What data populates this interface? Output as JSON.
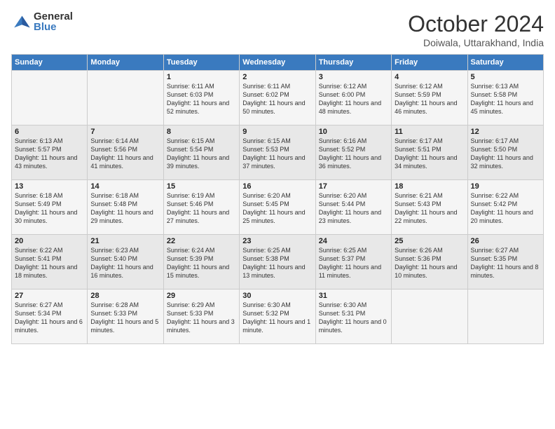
{
  "logo": {
    "general": "General",
    "blue": "Blue"
  },
  "header": {
    "month": "October 2024",
    "location": "Doiwala, Uttarakhand, India"
  },
  "days_of_week": [
    "Sunday",
    "Monday",
    "Tuesday",
    "Wednesday",
    "Thursday",
    "Friday",
    "Saturday"
  ],
  "weeks": [
    [
      {
        "day": "",
        "info": ""
      },
      {
        "day": "",
        "info": ""
      },
      {
        "day": "1",
        "info": "Sunrise: 6:11 AM\nSunset: 6:03 PM\nDaylight: 11 hours and 52 minutes."
      },
      {
        "day": "2",
        "info": "Sunrise: 6:11 AM\nSunset: 6:02 PM\nDaylight: 11 hours and 50 minutes."
      },
      {
        "day": "3",
        "info": "Sunrise: 6:12 AM\nSunset: 6:00 PM\nDaylight: 11 hours and 48 minutes."
      },
      {
        "day": "4",
        "info": "Sunrise: 6:12 AM\nSunset: 5:59 PM\nDaylight: 11 hours and 46 minutes."
      },
      {
        "day": "5",
        "info": "Sunrise: 6:13 AM\nSunset: 5:58 PM\nDaylight: 11 hours and 45 minutes."
      }
    ],
    [
      {
        "day": "6",
        "info": "Sunrise: 6:13 AM\nSunset: 5:57 PM\nDaylight: 11 hours and 43 minutes."
      },
      {
        "day": "7",
        "info": "Sunrise: 6:14 AM\nSunset: 5:56 PM\nDaylight: 11 hours and 41 minutes."
      },
      {
        "day": "8",
        "info": "Sunrise: 6:15 AM\nSunset: 5:54 PM\nDaylight: 11 hours and 39 minutes."
      },
      {
        "day": "9",
        "info": "Sunrise: 6:15 AM\nSunset: 5:53 PM\nDaylight: 11 hours and 37 minutes."
      },
      {
        "day": "10",
        "info": "Sunrise: 6:16 AM\nSunset: 5:52 PM\nDaylight: 11 hours and 36 minutes."
      },
      {
        "day": "11",
        "info": "Sunrise: 6:17 AM\nSunset: 5:51 PM\nDaylight: 11 hours and 34 minutes."
      },
      {
        "day": "12",
        "info": "Sunrise: 6:17 AM\nSunset: 5:50 PM\nDaylight: 11 hours and 32 minutes."
      }
    ],
    [
      {
        "day": "13",
        "info": "Sunrise: 6:18 AM\nSunset: 5:49 PM\nDaylight: 11 hours and 30 minutes."
      },
      {
        "day": "14",
        "info": "Sunrise: 6:18 AM\nSunset: 5:48 PM\nDaylight: 11 hours and 29 minutes."
      },
      {
        "day": "15",
        "info": "Sunrise: 6:19 AM\nSunset: 5:46 PM\nDaylight: 11 hours and 27 minutes."
      },
      {
        "day": "16",
        "info": "Sunrise: 6:20 AM\nSunset: 5:45 PM\nDaylight: 11 hours and 25 minutes."
      },
      {
        "day": "17",
        "info": "Sunrise: 6:20 AM\nSunset: 5:44 PM\nDaylight: 11 hours and 23 minutes."
      },
      {
        "day": "18",
        "info": "Sunrise: 6:21 AM\nSunset: 5:43 PM\nDaylight: 11 hours and 22 minutes."
      },
      {
        "day": "19",
        "info": "Sunrise: 6:22 AM\nSunset: 5:42 PM\nDaylight: 11 hours and 20 minutes."
      }
    ],
    [
      {
        "day": "20",
        "info": "Sunrise: 6:22 AM\nSunset: 5:41 PM\nDaylight: 11 hours and 18 minutes."
      },
      {
        "day": "21",
        "info": "Sunrise: 6:23 AM\nSunset: 5:40 PM\nDaylight: 11 hours and 16 minutes."
      },
      {
        "day": "22",
        "info": "Sunrise: 6:24 AM\nSunset: 5:39 PM\nDaylight: 11 hours and 15 minutes."
      },
      {
        "day": "23",
        "info": "Sunrise: 6:25 AM\nSunset: 5:38 PM\nDaylight: 11 hours and 13 minutes."
      },
      {
        "day": "24",
        "info": "Sunrise: 6:25 AM\nSunset: 5:37 PM\nDaylight: 11 hours and 11 minutes."
      },
      {
        "day": "25",
        "info": "Sunrise: 6:26 AM\nSunset: 5:36 PM\nDaylight: 11 hours and 10 minutes."
      },
      {
        "day": "26",
        "info": "Sunrise: 6:27 AM\nSunset: 5:35 PM\nDaylight: 11 hours and 8 minutes."
      }
    ],
    [
      {
        "day": "27",
        "info": "Sunrise: 6:27 AM\nSunset: 5:34 PM\nDaylight: 11 hours and 6 minutes."
      },
      {
        "day": "28",
        "info": "Sunrise: 6:28 AM\nSunset: 5:33 PM\nDaylight: 11 hours and 5 minutes."
      },
      {
        "day": "29",
        "info": "Sunrise: 6:29 AM\nSunset: 5:33 PM\nDaylight: 11 hours and 3 minutes."
      },
      {
        "day": "30",
        "info": "Sunrise: 6:30 AM\nSunset: 5:32 PM\nDaylight: 11 hours and 1 minute."
      },
      {
        "day": "31",
        "info": "Sunrise: 6:30 AM\nSunset: 5:31 PM\nDaylight: 11 hours and 0 minutes."
      },
      {
        "day": "",
        "info": ""
      },
      {
        "day": "",
        "info": ""
      }
    ]
  ]
}
